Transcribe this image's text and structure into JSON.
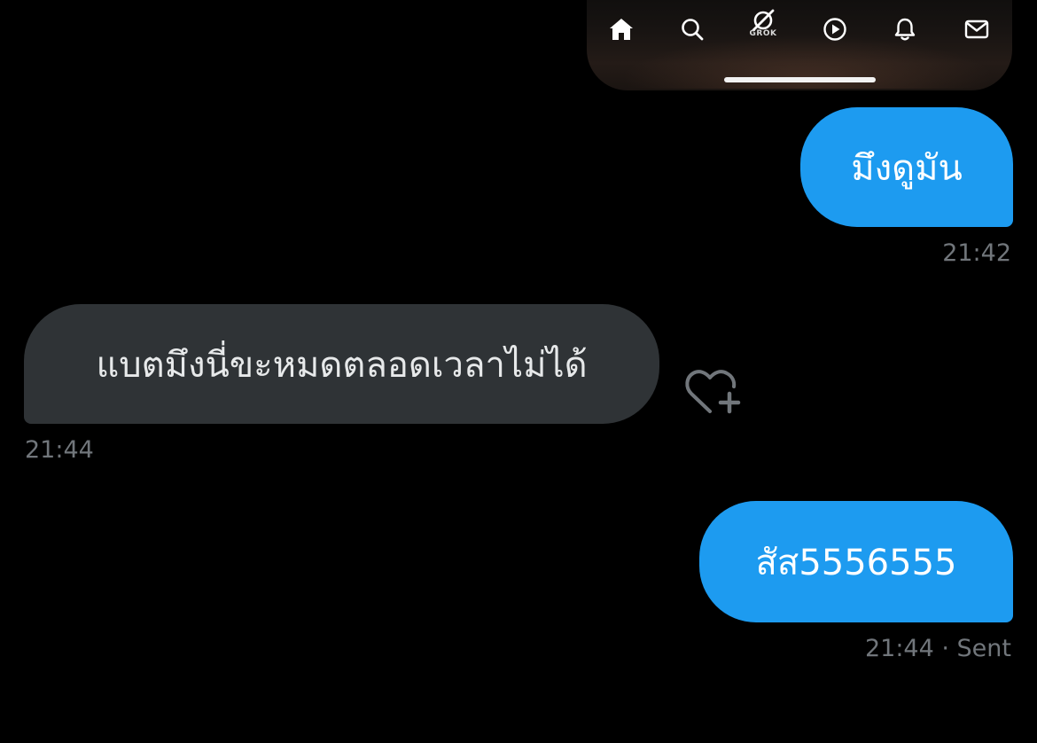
{
  "top_nav": {
    "items": [
      {
        "name": "home",
        "icon": "home-icon"
      },
      {
        "name": "search",
        "icon": "search-icon"
      },
      {
        "name": "grok",
        "icon": "grok-icon",
        "label": "GROK"
      },
      {
        "name": "video",
        "icon": "play-icon"
      },
      {
        "name": "notifications",
        "icon": "bell-icon"
      },
      {
        "name": "messages",
        "icon": "mail-icon"
      }
    ]
  },
  "colors": {
    "sent_bubble": "#1d9bf0",
    "received_bubble": "#2f3336",
    "background": "#000000",
    "meta_text": "#71767b"
  },
  "messages": [
    {
      "direction": "sent",
      "text": "มึงดูมัน",
      "time": "21:42"
    },
    {
      "direction": "received",
      "text": "แบตมึงนี่ขะหมดตลอดเวลาไม่ได้",
      "time": "21:44"
    },
    {
      "direction": "sent",
      "text": "สัส5556555",
      "time": "21:44",
      "status": "· Sent"
    }
  ],
  "reaction": {
    "icon": "heart-plus-icon"
  }
}
